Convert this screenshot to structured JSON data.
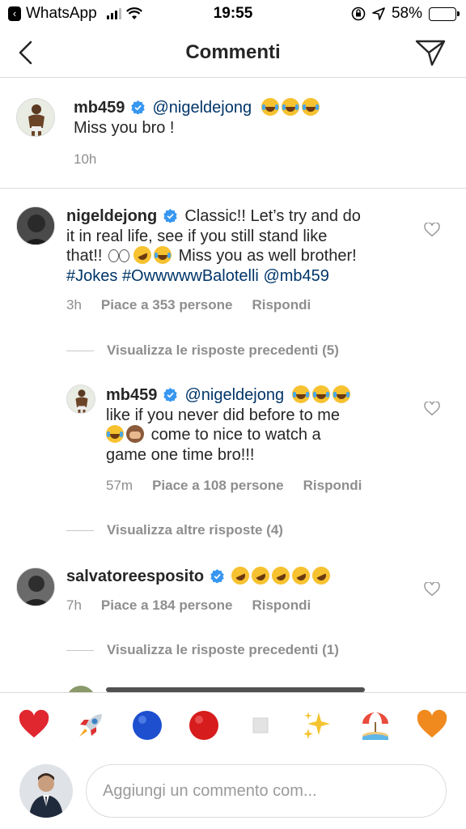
{
  "status_bar": {
    "back_app": "WhatsApp",
    "time": "19:55",
    "battery": "58%",
    "battery_level": 0.58
  },
  "nav": {
    "title": "Commenti",
    "back_icon": "chevron-left-icon",
    "send_icon": "paper-plane-icon"
  },
  "comments": [
    {
      "username": "mb459",
      "mention": "@nigeldejong",
      "line2": "Miss you bro !",
      "time": "10h"
    },
    {
      "username": "nigeldejong",
      "text1": "Classic!! Let’s try and do",
      "text2": "it in real life, see if you still stand like",
      "text3a": "that!!",
      "text3b": "Miss you as well brother!",
      "hashtag1": "#Jokes",
      "hashtag2": "#OwwwwwBalotelli",
      "mention": "@mb459",
      "time": "3h",
      "likes": "Piace a 353 persone",
      "reply": "Rispondi",
      "view_previous": "Visualizza le risposte precedenti (5)"
    },
    {
      "username": "mb459",
      "mention": "@nigeldejong",
      "text1": "like if you never did before to me",
      "text2": "come to nice to watch a",
      "text3": "game one time bro!!!",
      "time": "57m",
      "likes": "Piace a 108 persone",
      "reply": "Rispondi",
      "view_more": "Visualizza altre risposte (4)"
    },
    {
      "username": "salvatoreesposito",
      "time": "7h",
      "likes": "Piace a 184 persone",
      "reply": "Rispondi",
      "view_previous": "Visualizza le risposte precedenti (1)"
    }
  ],
  "reactions": [
    "heart",
    "rocket",
    "blue-circle",
    "red-circle",
    "white-square",
    "sparkles",
    "beach-umbrella",
    "orange-heart"
  ],
  "input": {
    "placeholder": "Aggiungi un commento com..."
  },
  "colors": {
    "link": "#003569",
    "verified": "#3897f0",
    "muted": "#8e8e8e"
  }
}
